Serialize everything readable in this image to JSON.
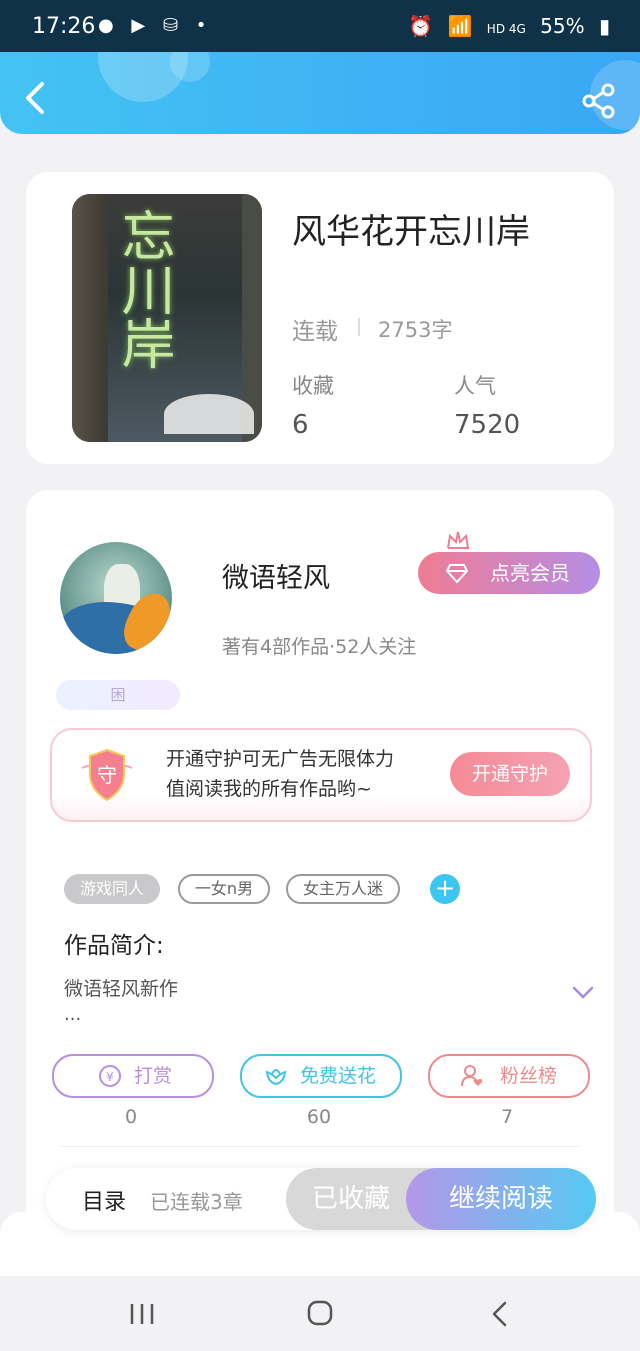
{
  "status_bar": {
    "time": "17:26",
    "left_icons": "● ▶ ⛁ •",
    "network": "HD 4G",
    "battery": "55%"
  },
  "header": {
    "back_icon": "chevron-left-icon",
    "share_icon": "share-icon"
  },
  "book": {
    "title": "风华花开忘川岸",
    "status": "连载",
    "words": "2753字",
    "cover_text": "忘川岸",
    "stats": [
      {
        "label": "收藏",
        "value": "6"
      },
      {
        "label": "人气",
        "value": "7520"
      }
    ]
  },
  "author": {
    "name": "微语轻风",
    "meta": "著有4部作品·52人关注",
    "badge": "困",
    "vip_button": "点亮会员"
  },
  "guard": {
    "shield_char": "守",
    "line1": "开通守护可无广告无限体力",
    "line2": "值阅读我的所有作品哟~",
    "button": "开通守护"
  },
  "tags": [
    "游戏同人",
    "一女n男",
    "女主万人迷"
  ],
  "intro": {
    "title": "作品简介:",
    "text": "微语轻风新作",
    "more": "..."
  },
  "actions": [
    {
      "label": "打赏",
      "count": "0",
      "color": "#b98ee0"
    },
    {
      "label": "免费送花",
      "count": "60",
      "color": "#3fc4e8"
    },
    {
      "label": "粉丝榜",
      "count": "7",
      "color": "#ef8a8a"
    }
  ],
  "bottom": {
    "toc": "目录",
    "toc_count": "已连载3章",
    "favorited": "已收藏",
    "continue": "继续阅读"
  }
}
